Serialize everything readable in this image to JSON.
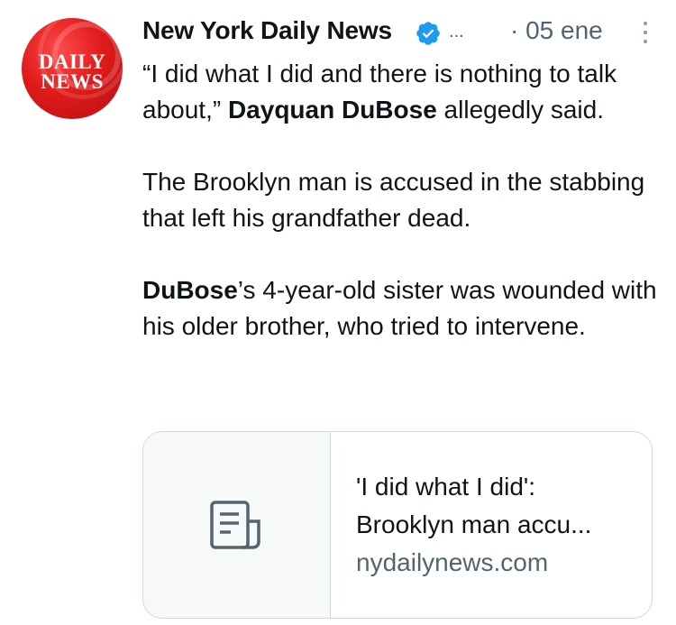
{
  "account": {
    "name": "New York Daily News",
    "avatar_text_line1": "DAILY",
    "avatar_text_line2": "NEWS",
    "verified_icon": "verified-badge-icon",
    "ellipsis": "...",
    "date": "· 05 ene",
    "more_icon": "more-vertical-icon"
  },
  "tweet": {
    "p1_part1": "“I did what I did and there is nothing to talk about,” ",
    "p1_bold": "Dayquan DuBose",
    "p1_part2": " allegedly said.",
    "p2": "The Brooklyn man is accused in the stabbing that left his grandfather dead.",
    "p3_bold": "DuBose",
    "p3_rest": "’s 4-year-old sister was wounded with his older brother, who tried to intervene."
  },
  "card": {
    "icon": "article-icon",
    "title_line1": "'I did what I did':",
    "title_line2": "Brooklyn man accu...",
    "domain": "nydailynews.com"
  },
  "colors": {
    "text": "#0f1419",
    "secondary": "#536471",
    "verified": "#1d9bf0",
    "avatar_red": "#e01b1b",
    "card_border": "#cfd9de"
  }
}
